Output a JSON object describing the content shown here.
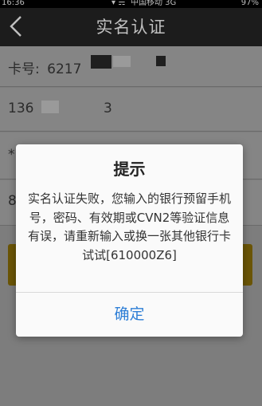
{
  "status_bar": {
    "time": "16:36",
    "signal": "▾ ☴",
    "carrier": "中国移动 3G",
    "battery": "97%"
  },
  "header": {
    "back_icon": "chevron-left",
    "title": "实名认证"
  },
  "form": {
    "card_label": "卡号:",
    "card_number_partial": "6217",
    "phone_partial": "136",
    "phone_digit": "3",
    "cvn_partial": "*",
    "expiry_partial": "8"
  },
  "dialog": {
    "title": "提示",
    "message": "实名认证失败，您输入的银行预留手机号，密码、有效期或CVN2等验证信息有误，请重新输入或换一张其他银行卡试试[610000Z6]",
    "ok_label": "确定"
  },
  "colors": {
    "accent_link": "#2f7fd6",
    "button_brand": "#6b5506"
  }
}
